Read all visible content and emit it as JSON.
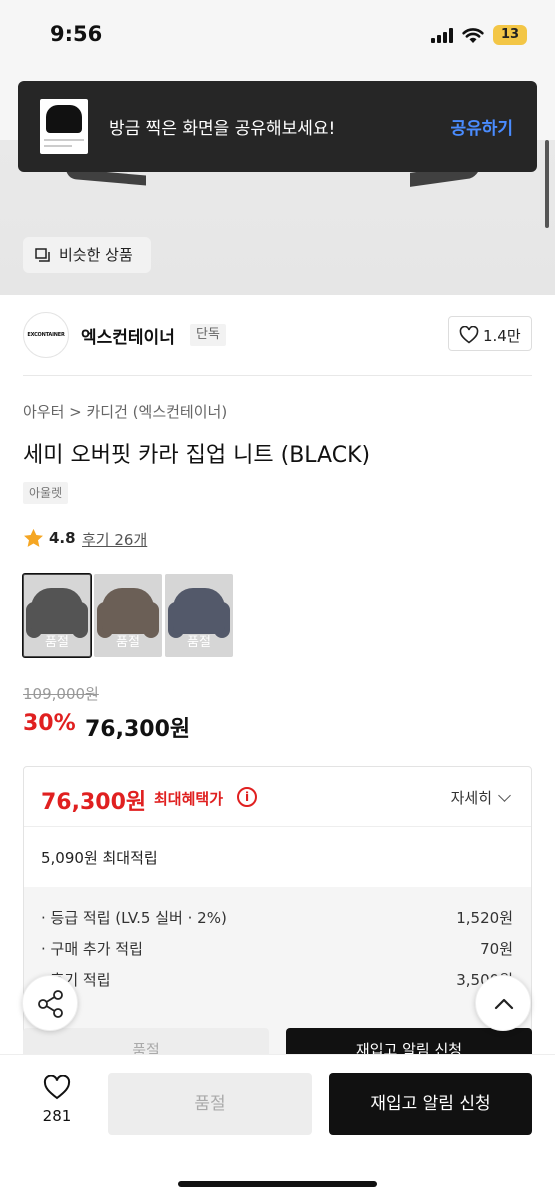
{
  "status": {
    "time": "9:56",
    "battery": "13"
  },
  "toast": {
    "message": "방금 찍은 화면을 공유해보세요!",
    "action": "공유하기"
  },
  "similar": {
    "label": "비슷한 상품"
  },
  "brand": {
    "name": "엑스컨테이너",
    "badge": "단독",
    "logo_text": "EXCONTAINER",
    "likes": "1.4만"
  },
  "breadcrumb": "아우터 > 카디건 (엑스컨테이너)",
  "product": {
    "title": "세미 오버핏 카라 집업 니트 (BLACK)",
    "tag": "아울렛"
  },
  "rating": {
    "score": "4.8",
    "reviews": "후기 26개"
  },
  "swatches": [
    {
      "label": "품절",
      "color": "#1b1b1b"
    },
    {
      "label": "품절",
      "color": "#3a2a1e"
    },
    {
      "label": "품절",
      "color": "#1a2238"
    }
  ],
  "price": {
    "original": "109,000원",
    "discount": "30%",
    "sale": "76,300원"
  },
  "benefit": {
    "max_price": "76,300원",
    "max_label": "최대혜택가",
    "detail": "자세히",
    "max_points": "5,090원 최대적립",
    "rows": [
      {
        "label": "· 등급 적립 (LV.5 실버 · 2%)",
        "value": "1,520원"
      },
      {
        "label": "· 구매 추가 적립",
        "value": "70원"
      },
      {
        "label": "· 후기 적립",
        "value": "3,500원"
      }
    ]
  },
  "ghost_buttons": {
    "left": "품절",
    "right": "재입고 알림 신청"
  },
  "bottom": {
    "wish_count": "281",
    "soldout": "품절",
    "restock": "재입고 알림 신청"
  },
  "colors": {
    "accent_red": "#e02020",
    "toast_link": "#4a8cff",
    "battery": "#f3c646"
  }
}
